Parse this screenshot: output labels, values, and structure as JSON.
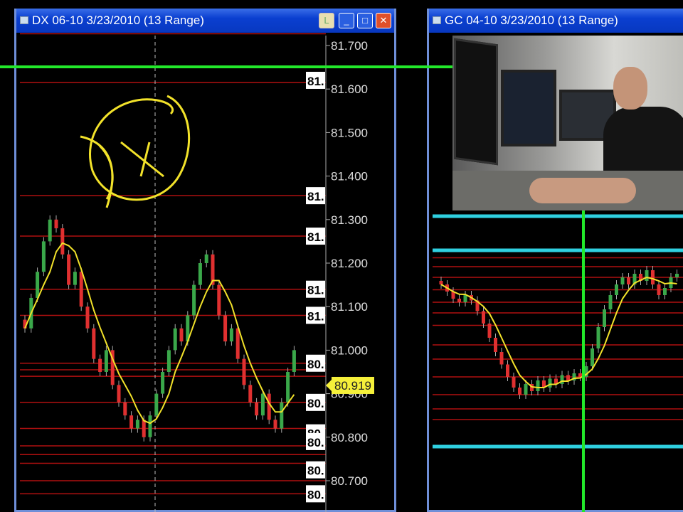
{
  "left_window": {
    "title": "DX 06-10  3/23/2010 (13 Range)",
    "buttons": [
      "L",
      "_",
      "□",
      "✕"
    ],
    "axis_labels": [
      "81.700",
      "81.600",
      "81.500",
      "81.400",
      "81.300",
      "81.200",
      "81.100",
      "81.000",
      "80.900",
      "80.800",
      "80.700"
    ],
    "axis_values": [
      81.7,
      81.6,
      81.5,
      81.4,
      81.3,
      81.2,
      81.1,
      81.0,
      80.9,
      80.8,
      80.7
    ],
    "current_price": "80.919",
    "current_value": 80.919,
    "level_labels": [
      "81.",
      "81.",
      "81.",
      "81.",
      "81.",
      "80.",
      "80.",
      "80.",
      "80.",
      "80.",
      "80."
    ],
    "level_values": [
      81.62,
      81.355,
      81.262,
      81.14,
      81.08,
      80.97,
      80.88,
      80.81,
      80.79,
      80.725,
      80.67
    ],
    "red_levels": [
      81.727,
      81.615,
      81.355,
      81.262,
      81.14,
      81.08,
      80.97,
      80.955,
      80.94,
      80.88,
      80.82,
      80.78,
      80.76,
      80.74,
      80.7,
      80.67
    ],
    "closes": [
      81.05,
      81.12,
      81.18,
      81.25,
      81.3,
      81.28,
      81.22,
      81.15,
      81.18,
      81.1,
      81.05,
      80.98,
      80.95,
      81.0,
      80.92,
      80.88,
      80.85,
      80.82,
      80.84,
      80.8,
      80.85,
      80.9,
      80.95,
      81.0,
      81.05,
      81.02,
      81.08,
      81.15,
      81.2,
      81.22,
      81.15,
      81.08,
      81.02,
      81.05,
      80.98,
      80.92,
      80.88,
      80.85,
      80.9,
      80.84,
      80.82,
      80.88,
      80.95,
      81.0
    ],
    "annotation": "DX"
  },
  "right_window": {
    "title": "GC 04-10  3/23/2010 (13 Range)",
    "closes": [
      80,
      76,
      72,
      70,
      74,
      71,
      65,
      58,
      50,
      42,
      35,
      28,
      22,
      18,
      24,
      20,
      26,
      22,
      27,
      24,
      29,
      26,
      30,
      28,
      34,
      44,
      56,
      66,
      74,
      80,
      84,
      80,
      86,
      82,
      88,
      80,
      74,
      78,
      84,
      86
    ],
    "red_levels": [
      95,
      90,
      84,
      77,
      70,
      64,
      57,
      46,
      38,
      28,
      18,
      10,
      4
    ],
    "colors": {
      "up": "#3aa84a",
      "down": "#e03030",
      "ma": "#f2e22a",
      "cyan": "#2fd0e0",
      "green": "#22e82a",
      "red_level": "#b01010"
    }
  },
  "colors": {
    "up": "#3aa84a",
    "down": "#e03030",
    "ma": "#f2e22a",
    "green": "#22e82a",
    "red_level": "#b01010",
    "tag": "#f5f03a"
  }
}
